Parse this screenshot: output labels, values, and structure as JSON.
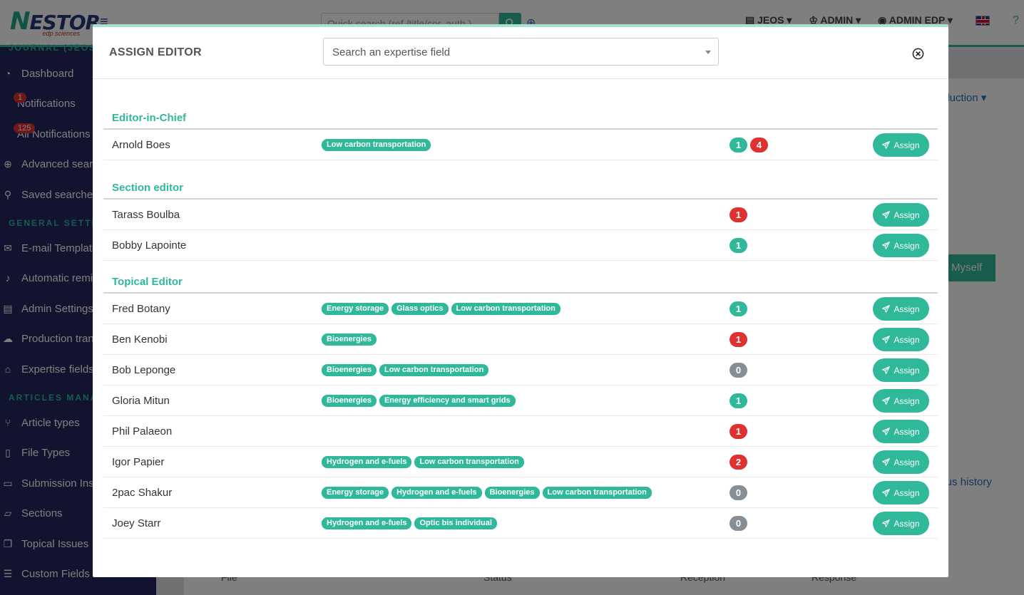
{
  "topbar": {
    "logo_text": "NESTOR",
    "logo_sub": "edp sciences",
    "quicksearch_placeholder": "Quick search (ref./title/cor. auth.)",
    "journal_menu": "JEOS",
    "role_menu": "ADMIN",
    "user_menu": "ADMIN EDP"
  },
  "sidebar": {
    "journal_heading": "JOURNAL (JEOS)",
    "items_top": [
      {
        "label": "Dashboard",
        "icon": "dashboard-icon"
      },
      {
        "label": "Notifications",
        "icon": "bell-icon",
        "badge": "1"
      },
      {
        "label": "All Notifications",
        "icon": "bell-outline-icon",
        "badge": "125"
      },
      {
        "label": "Advanced search",
        "icon": "search-plus-icon"
      },
      {
        "label": "Saved searches",
        "icon": "search-icon"
      }
    ],
    "general_heading": "GENERAL SETTINGS",
    "items_general": [
      {
        "label": "E-mail Templates",
        "icon": "email-template-icon"
      },
      {
        "label": "Automatic reminders",
        "icon": "bell-icon"
      },
      {
        "label": "Admin Settings",
        "icon": "keyboard-icon"
      },
      {
        "label": "Production transfer",
        "icon": "cloud-upload-icon"
      },
      {
        "label": "Expertise fields",
        "icon": "bank-icon"
      }
    ],
    "articles_heading": "ARTICLES MANAGEMENT",
    "items_articles": [
      {
        "label": "Article types",
        "icon": "branch-icon"
      },
      {
        "label": "File Types",
        "icon": "file-icon"
      },
      {
        "label": "Submission Instructions",
        "icon": "comment-icon"
      },
      {
        "label": "Sections",
        "icon": "folder-open-icon"
      },
      {
        "label": "Topical Issues",
        "icon": "copy-icon"
      },
      {
        "label": "Custom Fields",
        "icon": "list-icon"
      }
    ]
  },
  "background": {
    "production_menu": "Production",
    "myself_button": "Myself",
    "status_history": "Status history",
    "footer_cols": [
      "File",
      "Status",
      "Reception",
      "Response"
    ]
  },
  "modal": {
    "title": "ASSIGN EDITOR",
    "search_placeholder": "Search an expertise field",
    "assign_label": "Assign",
    "sections": [
      {
        "title": "Editor-in-Chief",
        "editors": [
          {
            "name": "Arnold Boes",
            "tags": [
              "Low carbon transportation"
            ],
            "counts": [
              {
                "value": "1",
                "color": "green"
              },
              {
                "value": "4",
                "color": "red"
              }
            ]
          }
        ]
      },
      {
        "title": "Section editor",
        "editors": [
          {
            "name": "Tarass Boulba",
            "tags": [],
            "counts": [
              {
                "value": "1",
                "color": "red"
              }
            ]
          },
          {
            "name": "Bobby Lapointe",
            "tags": [],
            "counts": [
              {
                "value": "1",
                "color": "green"
              }
            ]
          }
        ]
      },
      {
        "title": "Topical Editor",
        "editors": [
          {
            "name": "Fred Botany",
            "tags": [
              "Energy storage",
              "Glass optics",
              "Low carbon transportation"
            ],
            "counts": [
              {
                "value": "1",
                "color": "green"
              }
            ]
          },
          {
            "name": "Ben Kenobi",
            "tags": [
              "Bioenergies"
            ],
            "counts": [
              {
                "value": "1",
                "color": "red"
              }
            ]
          },
          {
            "name": "Bob Leponge",
            "tags": [
              "Bioenergies",
              "Low carbon transportation"
            ],
            "counts": [
              {
                "value": "0",
                "color": "grey"
              }
            ]
          },
          {
            "name": "Gloria Mitun",
            "tags": [
              "Bioenergies",
              "Energy efficiency and smart grids"
            ],
            "counts": [
              {
                "value": "1",
                "color": "green"
              }
            ]
          },
          {
            "name": "Phil Palaeon",
            "tags": [],
            "counts": [
              {
                "value": "1",
                "color": "red"
              }
            ]
          },
          {
            "name": "Igor Papier",
            "tags": [
              "Hydrogen and e-fuels",
              "Low carbon transportation"
            ],
            "counts": [
              {
                "value": "2",
                "color": "red"
              }
            ]
          },
          {
            "name": "2pac Shakur",
            "tags": [
              "Energy storage",
              "Hydrogen and e-fuels",
              "Bioenergies",
              "Low carbon transportation"
            ],
            "counts": [
              {
                "value": "0",
                "color": "grey"
              }
            ]
          },
          {
            "name": "Joey Starr",
            "tags": [
              "Hydrogen and e-fuels",
              "Optic bis individual"
            ],
            "counts": [
              {
                "value": "0",
                "color": "grey"
              }
            ]
          }
        ]
      }
    ]
  },
  "colors": {
    "accent": "#2fb89a",
    "sidebar": "#24265f",
    "danger": "#e03131",
    "neutral": "#868e96"
  }
}
